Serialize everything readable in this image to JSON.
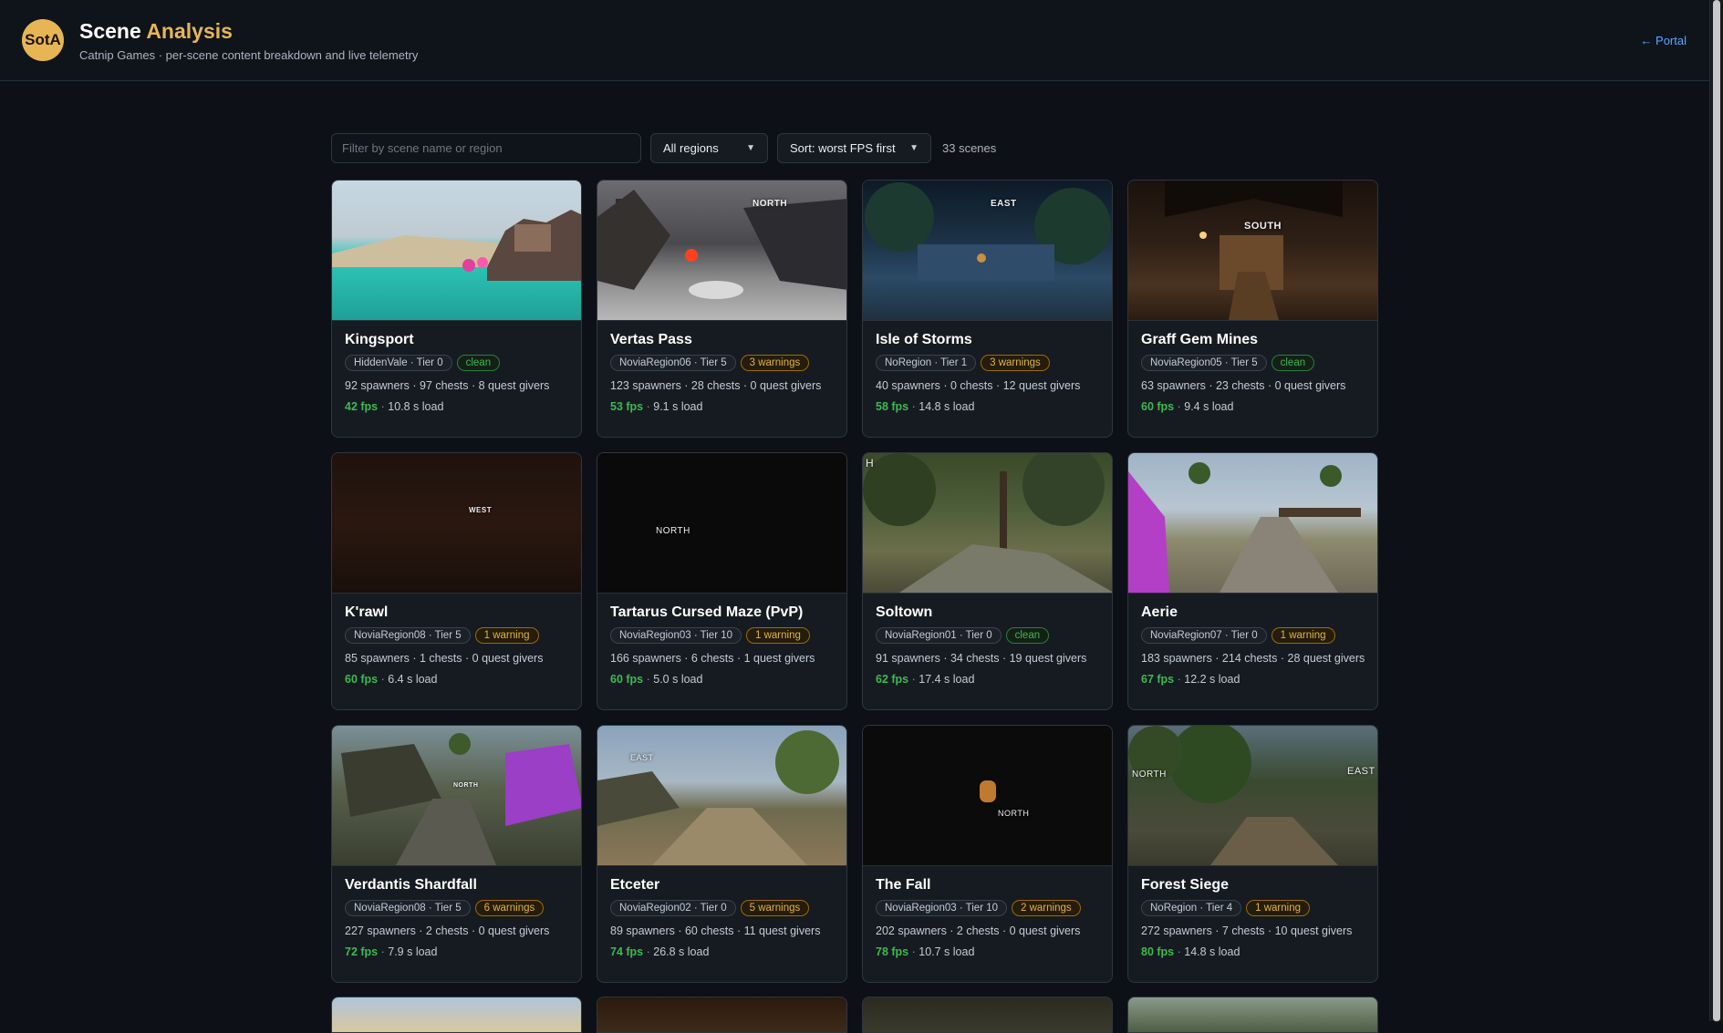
{
  "header": {
    "logo_text": "SotA",
    "title_main": "Scene",
    "title_accent": "Analysis",
    "subtitle": "Catnip Games · per-scene content breakdown and live telemetry",
    "portal_link": "← Portal"
  },
  "filters": {
    "search_placeholder": "Filter by scene name or region",
    "region_select": "All regions",
    "sort_select": "Sort: worst FPS first",
    "scene_count": "33 scenes"
  },
  "cards": [
    {
      "name": "Kingsport",
      "region": "HiddenVale · Tier 0",
      "status": "clean",
      "status_type": "clean",
      "stats": "92 spawners · 97 chests · 8 quest givers",
      "fps": "42 fps",
      "load": "10.8 s load",
      "overlay": ""
    },
    {
      "name": "Vertas Pass",
      "region": "NoviaRegion06 · Tier 5",
      "status": "3 warnings",
      "status_type": "warn",
      "stats": "123 spawners · 28 chests · 0 quest givers",
      "fps": "53 fps",
      "load": "9.1 s load",
      "overlay": "NORTH"
    },
    {
      "name": "Isle of Storms",
      "region": "NoRegion · Tier 1",
      "status": "3 warnings",
      "status_type": "warn",
      "stats": "40 spawners · 0 chests · 12 quest givers",
      "fps": "58 fps",
      "load": "14.8 s load",
      "overlay": "EAST"
    },
    {
      "name": "Graff Gem Mines",
      "region": "NoviaRegion05 · Tier 5",
      "status": "clean",
      "status_type": "clean",
      "stats": "63 spawners · 23 chests · 0 quest givers",
      "fps": "60 fps",
      "load": "9.4 s load",
      "overlay": "SOUTH"
    },
    {
      "name": "K'rawl",
      "region": "NoviaRegion08 · Tier 5",
      "status": "1 warning",
      "status_type": "warn",
      "stats": "85 spawners · 1 chests · 0 quest givers",
      "fps": "60 fps",
      "load": "6.4 s load",
      "overlay": "WEST"
    },
    {
      "name": "Tartarus Cursed Maze (PvP)",
      "region": "NoviaRegion03 · Tier 10",
      "status": "1 warning",
      "status_type": "warn",
      "stats": "166 spawners · 6 chests · 1 quest givers",
      "fps": "60 fps",
      "load": "5.0 s load",
      "overlay": "NORTH"
    },
    {
      "name": "Soltown",
      "region": "NoviaRegion01 · Tier 0",
      "status": "clean",
      "status_type": "clean",
      "stats": "91 spawners · 34 chests · 19 quest givers",
      "fps": "62 fps",
      "load": "17.4 s load",
      "overlay": "H"
    },
    {
      "name": "Aerie",
      "region": "NoviaRegion07 · Tier 0",
      "status": "1 warning",
      "status_type": "warn",
      "stats": "183 spawners · 214 chests · 28 quest givers",
      "fps": "67 fps",
      "load": "12.2 s load",
      "overlay": ""
    },
    {
      "name": "Verdantis Shardfall",
      "region": "NoviaRegion08 · Tier 5",
      "status": "6 warnings",
      "status_type": "warn",
      "stats": "227 spawners · 2 chests · 0 quest givers",
      "fps": "72 fps",
      "load": "7.9 s load",
      "overlay": "NORTH"
    },
    {
      "name": "Etceter",
      "region": "NoviaRegion02 · Tier 0",
      "status": "5 warnings",
      "status_type": "warn",
      "stats": "89 spawners · 60 chests · 11 quest givers",
      "fps": "74 fps",
      "load": "26.8 s load",
      "overlay": "EAST"
    },
    {
      "name": "The Fall",
      "region": "NoviaRegion03 · Tier 10",
      "status": "2 warnings",
      "status_type": "warn",
      "stats": "202 spawners · 2 chests · 0 quest givers",
      "fps": "78 fps",
      "load": "10.7 s load",
      "overlay": "NORTH"
    },
    {
      "name": "Forest Siege",
      "region": "NoRegion · Tier 4",
      "status": "1 warning",
      "status_type": "warn",
      "stats": "272 spawners · 7 chests · 10 quest givers",
      "fps": "80 fps",
      "load": "14.8 s load",
      "overlay": "NORTH"
    }
  ],
  "colors": {
    "accent": "#e8b554",
    "link": "#58a6ff",
    "fps_good": "#3fb950",
    "warning": "#e3b341"
  }
}
